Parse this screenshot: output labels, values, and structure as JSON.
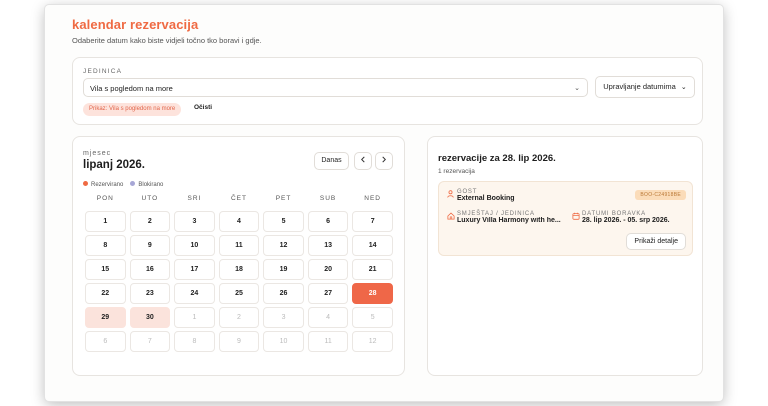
{
  "header": {
    "title": "kalendar rezervacija",
    "subtitle": "Odaberite datum kako biste vidjeli točno tko boravi i gdje."
  },
  "unit_filter": {
    "label": "JEDINICA",
    "selected": "Vila s pogledom na more",
    "manage_label": "Upravljanje datumima",
    "chip_text": "Prikaz: Vila s pogledom na more",
    "clear_label": "Očisti"
  },
  "calendar": {
    "label": "mjesec",
    "month_title": "lipanj 2026.",
    "today_label": "Danas",
    "prev_icon": "chevron-left-icon",
    "next_icon": "chevron-right-icon",
    "legend": [
      {
        "label": "Rezervirano",
        "color": "#ef6a43"
      },
      {
        "label": "Blokirano",
        "color": "#a7a7d6"
      }
    ],
    "weekdays": [
      "PON",
      "UTO",
      "SRI",
      "ČET",
      "PET",
      "SUB",
      "NED"
    ],
    "days": [
      {
        "d": "1",
        "state": ""
      },
      {
        "d": "2",
        "state": ""
      },
      {
        "d": "3",
        "state": ""
      },
      {
        "d": "4",
        "state": ""
      },
      {
        "d": "5",
        "state": ""
      },
      {
        "d": "6",
        "state": ""
      },
      {
        "d": "7",
        "state": ""
      },
      {
        "d": "8",
        "state": ""
      },
      {
        "d": "9",
        "state": ""
      },
      {
        "d": "10",
        "state": ""
      },
      {
        "d": "11",
        "state": ""
      },
      {
        "d": "12",
        "state": ""
      },
      {
        "d": "13",
        "state": ""
      },
      {
        "d": "14",
        "state": ""
      },
      {
        "d": "15",
        "state": ""
      },
      {
        "d": "16",
        "state": ""
      },
      {
        "d": "17",
        "state": ""
      },
      {
        "d": "18",
        "state": ""
      },
      {
        "d": "19",
        "state": ""
      },
      {
        "d": "20",
        "state": ""
      },
      {
        "d": "21",
        "state": ""
      },
      {
        "d": "22",
        "state": ""
      },
      {
        "d": "23",
        "state": ""
      },
      {
        "d": "24",
        "state": ""
      },
      {
        "d": "25",
        "state": ""
      },
      {
        "d": "26",
        "state": ""
      },
      {
        "d": "27",
        "state": ""
      },
      {
        "d": "28",
        "state": "selected"
      },
      {
        "d": "29",
        "state": "booked"
      },
      {
        "d": "30",
        "state": "booked"
      },
      {
        "d": "1",
        "state": "outside"
      },
      {
        "d": "2",
        "state": "outside"
      },
      {
        "d": "3",
        "state": "outside"
      },
      {
        "d": "4",
        "state": "outside"
      },
      {
        "d": "5",
        "state": "outside"
      },
      {
        "d": "6",
        "state": "outside"
      },
      {
        "d": "7",
        "state": "outside"
      },
      {
        "d": "8",
        "state": "outside"
      },
      {
        "d": "9",
        "state": "outside"
      },
      {
        "d": "10",
        "state": "outside"
      },
      {
        "d": "11",
        "state": "outside"
      },
      {
        "d": "12",
        "state": "outside"
      }
    ]
  },
  "reservations": {
    "title": "rezervacije za 28. lip 2026.",
    "count": "1 rezervacija",
    "items": [
      {
        "guest_label": "GOST",
        "guest_name": "External Booking",
        "code": "BOO-C24918BE",
        "unit_label": "SMJEŠTAJ / JEDINICA",
        "unit_name": "Luxury Villa Harmony with he...",
        "dates_label": "DATUMI BORAVKA",
        "dates": "28. lip 2026. - 05. srp 2026.",
        "details_label": "Prikaži detalje"
      }
    ]
  }
}
